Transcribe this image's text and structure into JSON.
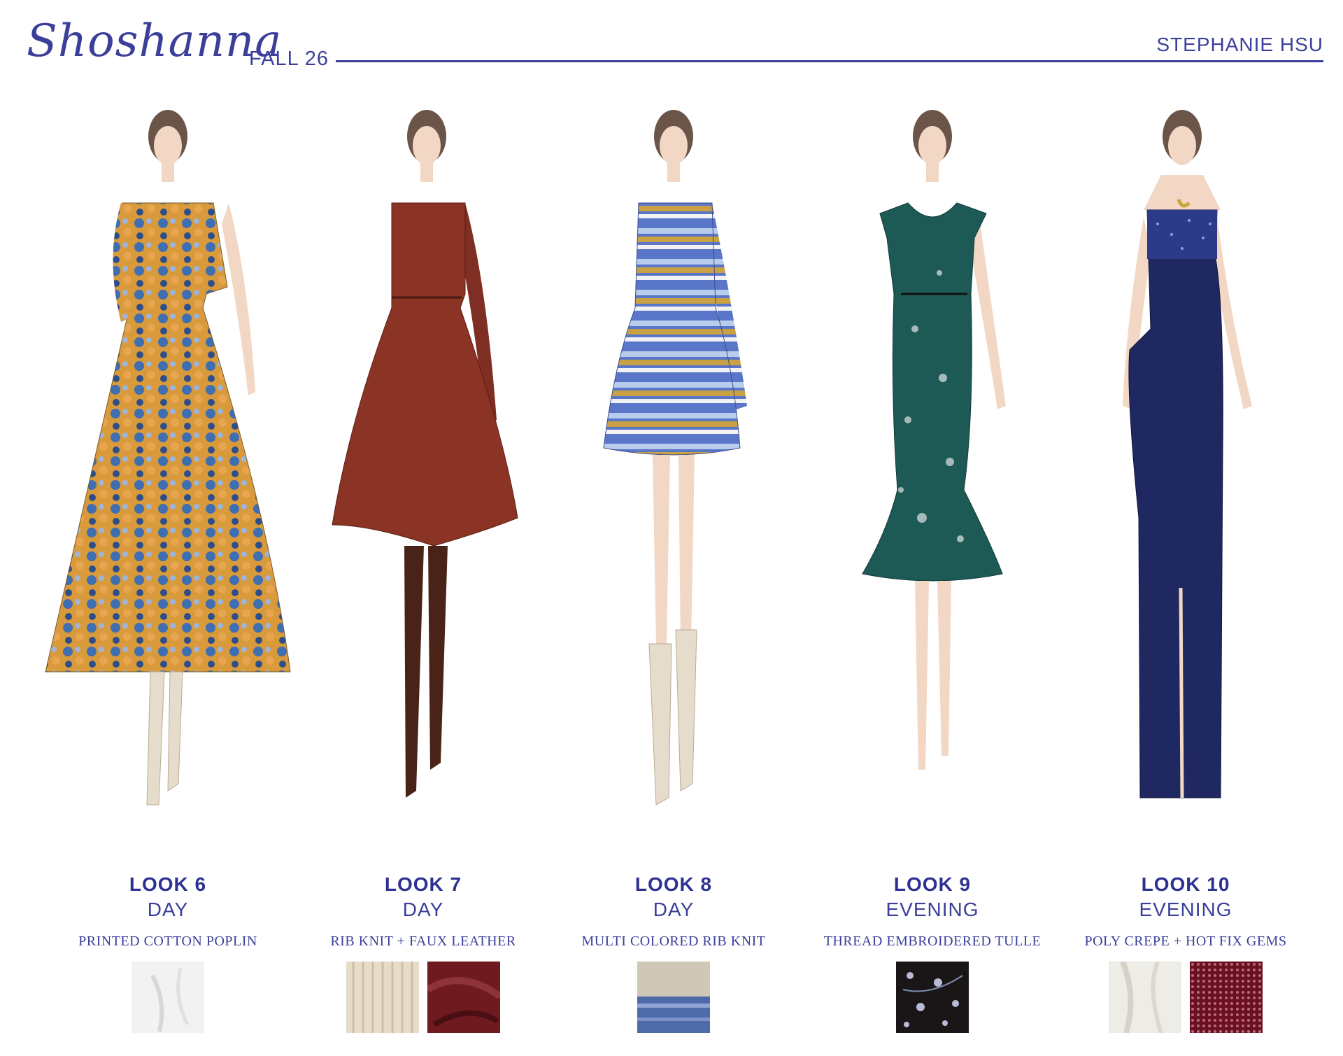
{
  "header": {
    "brand": "Shoshanna",
    "season": "FALL 26",
    "designer": "STEPHANIE HSU"
  },
  "colors": {
    "accent": "#2e3192"
  },
  "looks": [
    {
      "title": "LOOK 6",
      "type": "DAY",
      "fabric": "PRINTED COTTON POPLIN",
      "garment": "orange-floral-maxi-dress",
      "swatches": [
        "white-cotton-swatch"
      ]
    },
    {
      "title": "LOOK 7",
      "type": "DAY",
      "fabric": "RIB KNIT + FAUX LEATHER",
      "garment": "rust-rib-knit-dress",
      "swatches": [
        "cream-rib-knit-swatch",
        "burgundy-faux-leather-swatch"
      ]
    },
    {
      "title": "LOOK 8",
      "type": "DAY",
      "fabric": "MULTI COLORED RIB KNIT",
      "garment": "blue-striped-knit-dress",
      "swatches": [
        "multi-rib-knit-swatch"
      ]
    },
    {
      "title": "LOOK 9",
      "type": "EVENING",
      "fabric": "THREAD EMBROIDERED TULLE",
      "garment": "teal-embroidered-dress",
      "swatches": [
        "black-embroidered-tulle-swatch"
      ]
    },
    {
      "title": "LOOK 10",
      "type": "EVENING",
      "fabric": "POLY CREPE + HOT FIX GEMS",
      "garment": "navy-strapless-gown",
      "swatches": [
        "ivory-crepe-swatch",
        "burgundy-gem-mesh-swatch"
      ]
    }
  ]
}
